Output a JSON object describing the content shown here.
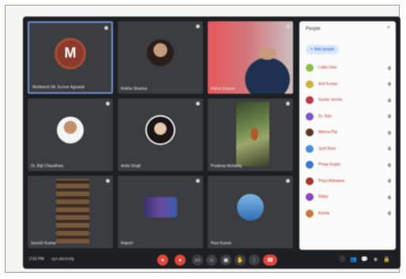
{
  "tiles": [
    {
      "name": "Nishkarsh Mr. Kumar Agrawal",
      "type": "letter",
      "letter": "M",
      "active": true
    },
    {
      "name": "Rekha Sharma",
      "type": "photo-face"
    },
    {
      "name": "Rahul Kapoor",
      "type": "video-1"
    },
    {
      "name": "Dr. Bijit Chaudhary",
      "type": "photo-face3"
    },
    {
      "name": "Anita Singh",
      "type": "photo-face2"
    },
    {
      "name": "Pradeep Mohanty",
      "type": "video-2"
    },
    {
      "name": "Suresh Kumar",
      "type": "video-3"
    },
    {
      "name": "Rajesh",
      "type": "photo-group"
    },
    {
      "name": "Ravi Kumar",
      "type": "photo-blue"
    }
  ],
  "panel": {
    "title": "People",
    "close": "×",
    "add_label": "Add people",
    "participants": [
      {
        "name": "Lalita Devi",
        "color": "#8bbf4a"
      },
      {
        "name": "Anil Kumar",
        "color": "#c8b23a"
      },
      {
        "name": "Sunita Verma",
        "color": "#c0394a"
      },
      {
        "name": "Dr. Rao",
        "color": "#7b57c7"
      },
      {
        "name": "Meena Pal",
        "color": "#5a3a2a"
      },
      {
        "name": "Jyoti Rani",
        "color": "#4a8fd8"
      },
      {
        "name": "Pooja Gupta",
        "color": "#3b78c9"
      },
      {
        "name": "Priya Mahawar",
        "color": "#a03a30"
      },
      {
        "name": "Ritika",
        "color": "#8a47b8"
      },
      {
        "name": "Kavita",
        "color": "#c77a3a"
      }
    ]
  },
  "bar": {
    "clock": "2:02 PM",
    "meeting_code": "xyz-abcd-efg",
    "controls": [
      "mic-off",
      "cam-off",
      "captions",
      "emoji",
      "present",
      "raise-hand",
      "more",
      "end-call"
    ],
    "right_icons": [
      "info",
      "people",
      "chat",
      "activities",
      "lock"
    ]
  },
  "colors": {
    "window_bg": "#1d1f22",
    "tile_bg": "#3b3d40",
    "accent": "#1a5fd0",
    "end_call": "#e2463a"
  }
}
